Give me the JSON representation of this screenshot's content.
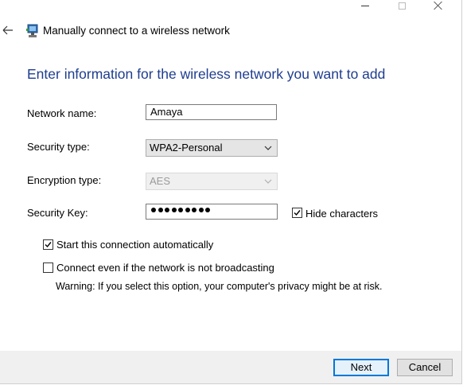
{
  "window": {
    "title": "Manually connect to a wireless network"
  },
  "heading": "Enter information for the wireless network you want to add",
  "form": {
    "network_name": {
      "label": "Network name:",
      "value": "Amaya"
    },
    "security_type": {
      "label": "Security type:",
      "value": "WPA2-Personal"
    },
    "encryption_type": {
      "label": "Encryption type:",
      "value": "AES"
    },
    "security_key": {
      "label": "Security Key:",
      "masked_length": 9
    },
    "hide_characters": {
      "label": "Hide characters",
      "checked": true
    }
  },
  "options": {
    "start_automatically": {
      "label": "Start this connection automatically",
      "checked": true
    },
    "connect_not_broadcasting": {
      "label": "Connect even if the network is not broadcasting",
      "checked": false
    },
    "warning": "Warning: If you select this option, your computer's privacy might be at risk."
  },
  "buttons": {
    "next": "Next",
    "cancel": "Cancel"
  },
  "icons": {
    "back": "back-arrow-icon",
    "network": "wireless-network-icon",
    "minimize": "minimize-icon",
    "maximize": "maximize-icon",
    "close": "close-icon",
    "dropdown": "chevron-down-icon",
    "check": "checkmark-icon"
  },
  "colors": {
    "heading": "#1e3d8f",
    "default_button_border": "#0078d7",
    "footer": "#f0f0f0"
  }
}
